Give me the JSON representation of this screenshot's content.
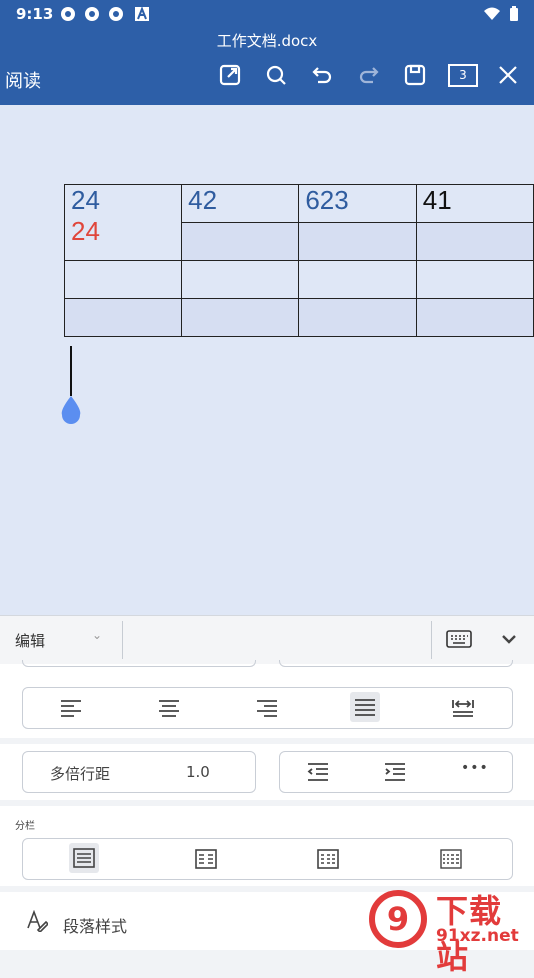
{
  "status": {
    "time": "9:13"
  },
  "header": {
    "doc_title": "工作文档.docx",
    "read_label": "阅读",
    "page_count": "3"
  },
  "table": {
    "rows": [
      [
        "24",
        "42",
        "623",
        "41"
      ],
      [
        "",
        "",
        "",
        ""
      ],
      [
        "",
        "",
        "",
        ""
      ],
      [
        "",
        "",
        "",
        ""
      ]
    ],
    "extra_text": "24"
  },
  "edit_bar": {
    "label": "编辑",
    "dropdown": "⌄"
  },
  "paragraph": {
    "line_spacing_label": "多倍行距",
    "line_spacing_value": "1.0",
    "more": "•••"
  },
  "columns": {
    "title": "分栏"
  },
  "style": {
    "label": "段落样式"
  },
  "watermark": {
    "brand": "下载站",
    "domain": "91xz.net",
    "digit": "9"
  },
  "colors": {
    "header": "#2d5fa8",
    "doc_bg": "#dfe7f6",
    "handle": "#5b8ef0",
    "watermark": "#e23b3b"
  }
}
